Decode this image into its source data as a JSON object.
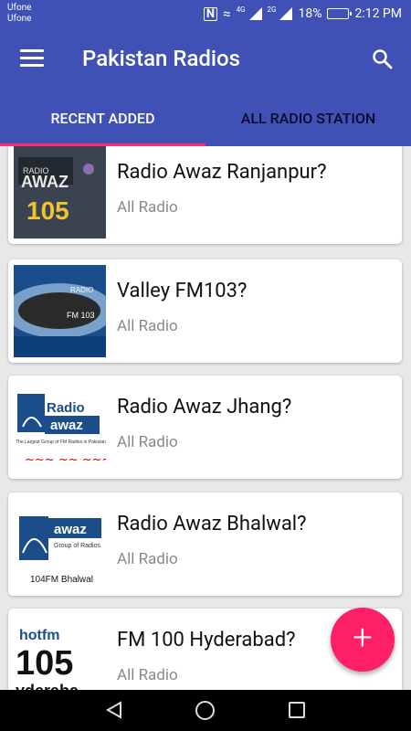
{
  "status": {
    "carrier_1": "Ufone",
    "carrier_2": "Ufone",
    "net_1": "4G",
    "net_2": "2G",
    "battery": "18%",
    "time": "2:12 PM"
  },
  "app_bar": {
    "title": "Pakistan Radios",
    "menu_icon": "hamburger-menu-icon",
    "search_icon": "search-icon"
  },
  "tabs": [
    {
      "label": "RECENT ADDED",
      "active": true
    },
    {
      "label": "ALL RADIO STATION",
      "active": false
    }
  ],
  "stations": [
    {
      "title": "Radio Awaz Ranjanpur?",
      "subtitle": "All Radio",
      "logo_text": "AWAZ 105"
    },
    {
      "title": "Valley FM103?",
      "subtitle": "All Radio",
      "logo_text": "RADIO FM 103"
    },
    {
      "title": "Radio Awaz Jhang?",
      "subtitle": "All Radio",
      "logo_text": "Radio awaz"
    },
    {
      "title": "Radio Awaz Bhalwal?",
      "subtitle": "All Radio",
      "logo_text": "awaz 104FM Bhalwal"
    },
    {
      "title": "FM 100 Hyderabad?",
      "subtitle": "All Radio",
      "logo_text": "hotfm 105 yderaba"
    }
  ],
  "fab": {
    "icon": "plus-icon",
    "label": "+"
  },
  "colors": {
    "primary": "#3f51b5",
    "accent": "#ff1f66"
  }
}
